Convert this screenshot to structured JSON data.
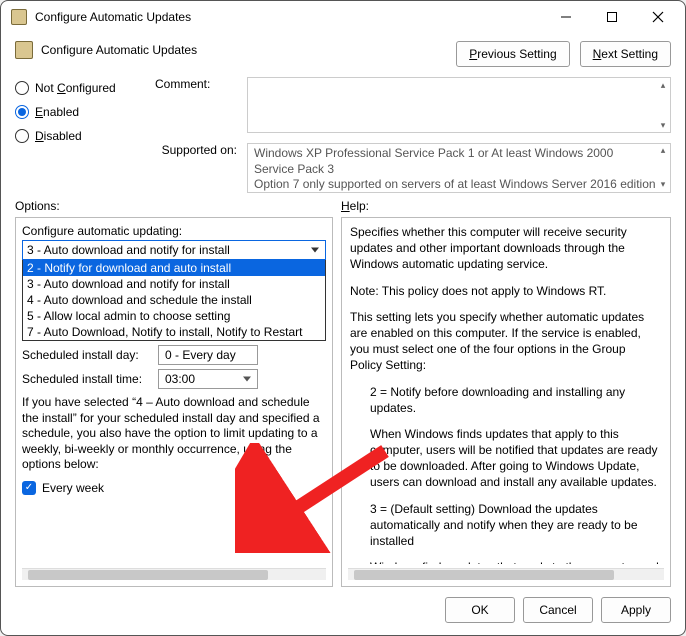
{
  "window": {
    "title": "Configure Automatic Updates"
  },
  "header": {
    "policy_title": "Configure Automatic Updates",
    "prev_char": "P",
    "prev_rest": "revious Setting",
    "next_char": "N",
    "next_rest": "ext Setting"
  },
  "radios": {
    "not_configured": "Not Configured",
    "enabled": "Enabled",
    "disabled": "Disabled",
    "not_configured_ul": "C",
    "enabled_ul": "E",
    "disabled_ul": "D"
  },
  "form": {
    "comment_label": "Comment:",
    "supported_label": "Supported on:",
    "supported_text": "Windows XP Professional Service Pack 1 or At least Windows 2000 Service Pack 3\nOption 7 only supported on servers of at least Windows Server 2016 edition"
  },
  "labels": {
    "options": "Options:",
    "help": "Help:"
  },
  "options_panel": {
    "configure_label": "Configure automatic updating:",
    "selected_value": "3 - Auto download and notify for install",
    "dropdown_items": [
      {
        "label": "2 - Notify for download and auto install",
        "selected": true
      },
      {
        "label": "3 - Auto download and notify for install",
        "selected": false
      },
      {
        "label": "4 - Auto download and schedule the install",
        "selected": false
      },
      {
        "label": "5 - Allow local admin to choose setting",
        "selected": false
      },
      {
        "label": "7 - Auto Download, Notify to install, Notify to Restart",
        "selected": false
      }
    ],
    "sched_day_label": "Scheduled install day:",
    "sched_day_value": "0 - Every day",
    "sched_time_label": "Scheduled install time:",
    "sched_time_value": "03:00",
    "paragraph": "If you have selected “4 – Auto download and schedule the install” for your scheduled install day and specified a schedule, you also have the option to limit updating to a weekly, bi-weekly or monthly occurrence, using the options below:",
    "every_week": "Every week"
  },
  "help_panel": {
    "p1": "Specifies whether this computer will receive security updates and other important downloads through the Windows automatic updating service.",
    "p2": "Note: This policy does not apply to Windows RT.",
    "p3": "This setting lets you specify whether automatic updates are enabled on this computer. If the service is enabled, you must select one of the four options in the Group Policy Setting:",
    "p4": "2 = Notify before downloading and installing any updates.",
    "p5": "When Windows finds updates that apply to this computer, users will be notified that updates are ready to be downloaded. After going to Windows Update, users can download and install any available updates.",
    "p6": "3 = (Default setting) Download the updates automatically and notify when they are ready to be installed",
    "p7": "Windows finds updates that apply to the computer and"
  },
  "buttons": {
    "ok": "OK",
    "cancel": "Cancel",
    "apply": "Apply"
  }
}
